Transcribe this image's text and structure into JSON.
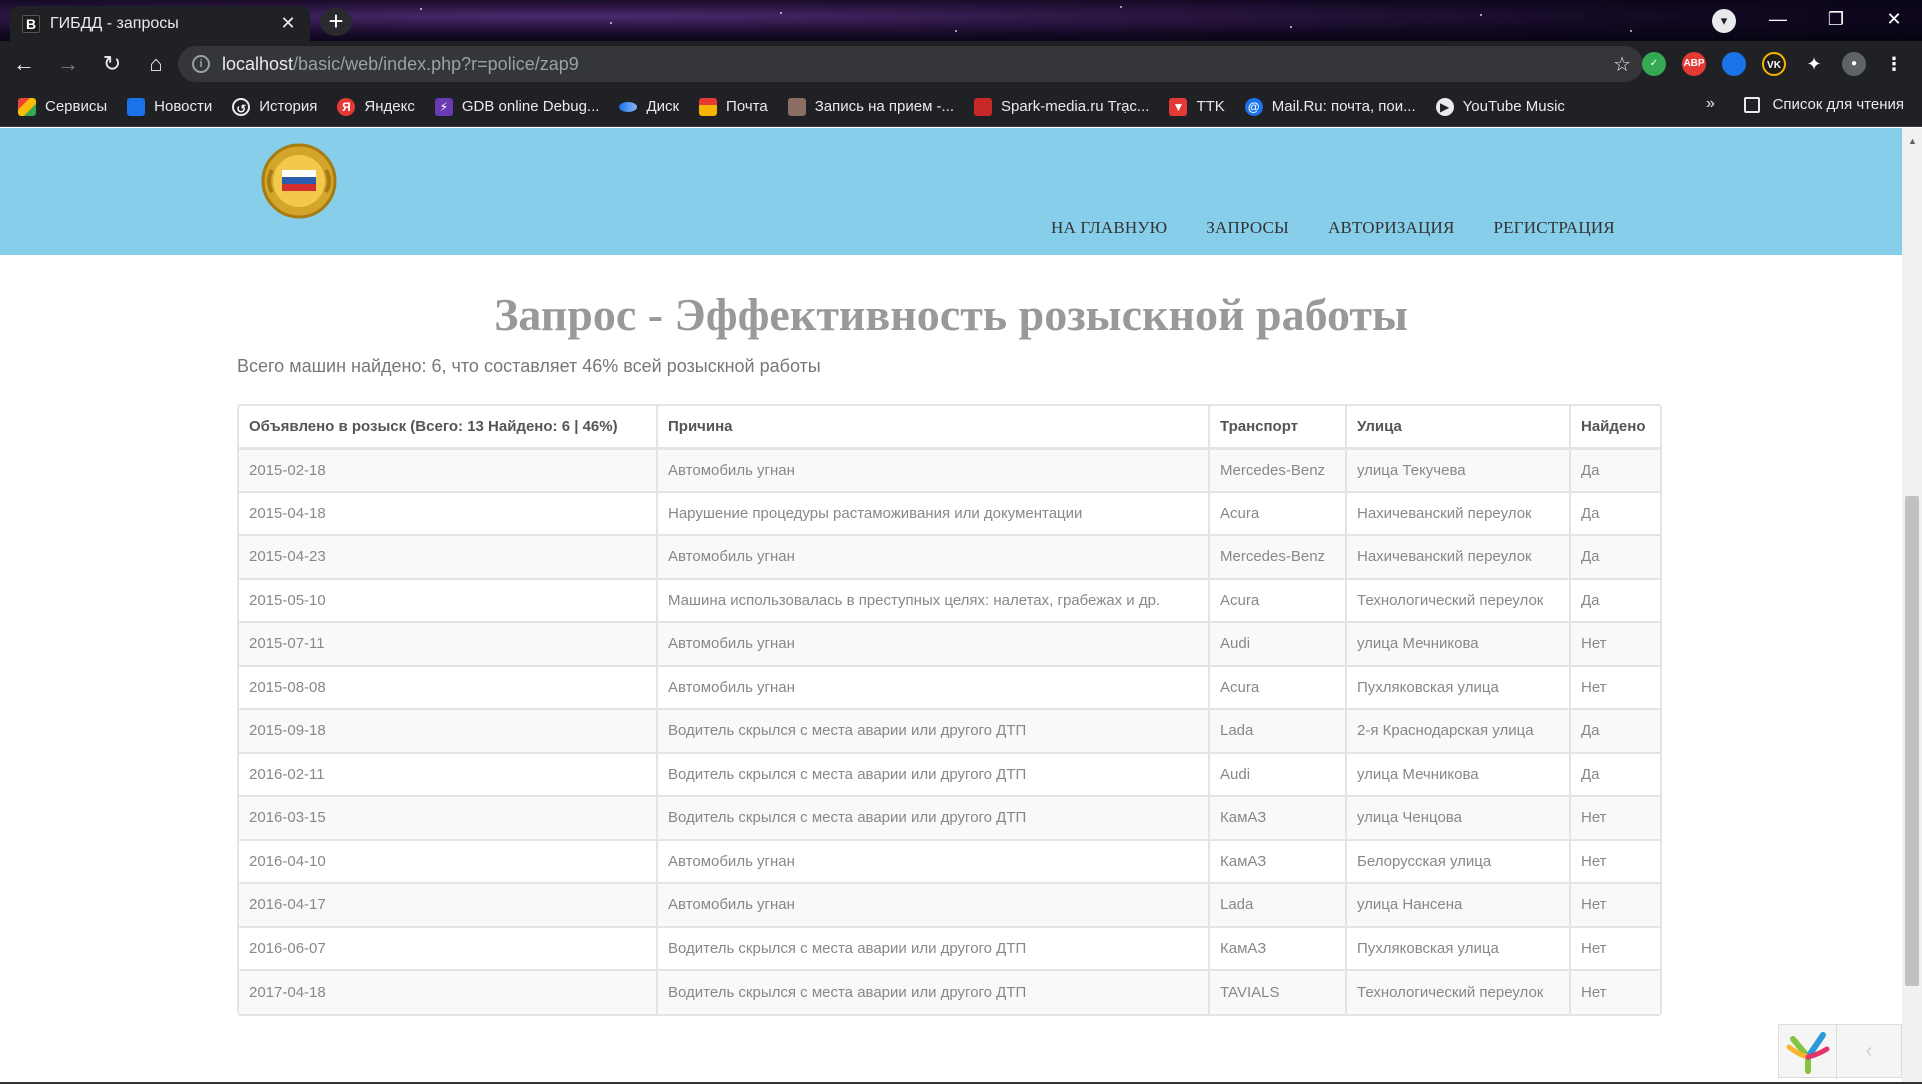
{
  "browser": {
    "tab_title": "ГИБДД - запросы",
    "tab_favicon": "В",
    "url_host": "localhost",
    "url_path": "/basic/web/index.php?r=police/zap9",
    "extensions": [
      {
        "name": "shield-extension-icon",
        "color": "#34a853",
        "label": ""
      },
      {
        "name": "adblock-extension-icon",
        "color": "#e53935",
        "label": "ABP"
      },
      {
        "name": "blue-extension-icon",
        "color": "#1a73e8",
        "label": ""
      },
      {
        "name": "vk-extension-icon",
        "color": "#1c1c1c",
        "label": "VK"
      }
    ]
  },
  "bookmarks": {
    "items": [
      {
        "label": "Сервисы",
        "icon": "apps-grid-icon",
        "color": "#ea4335"
      },
      {
        "label": "Новости",
        "icon": "news-icon",
        "color": "#1a73e8"
      },
      {
        "label": "История",
        "icon": "history-icon",
        "color": "#202124"
      },
      {
        "label": "Яндекс",
        "icon": "yandex-icon",
        "color": "#e53935"
      },
      {
        "label": "GDB online Debug...",
        "icon": "gdb-icon",
        "color": "#6a3ab2"
      },
      {
        "label": "Диск",
        "icon": "disk-icon",
        "color": "#1a73e8"
      },
      {
        "label": "Почта",
        "icon": "mail-icon",
        "color": "#f4b400"
      },
      {
        "label": "Запись на прием -...",
        "icon": "emblem-icon",
        "color": "#8d6e63"
      },
      {
        "label": "Spark-media.ru Trạc...",
        "icon": "spark-icon",
        "color": "#c62828"
      },
      {
        "label": "TTK",
        "icon": "ttk-icon",
        "color": "#e53935"
      },
      {
        "label": "Mail.Ru: почта, пои...",
        "icon": "mailru-icon",
        "color": "#1a73e8"
      },
      {
        "label": "YouTube Music",
        "icon": "youtube-music-icon",
        "color": "#e8eaed"
      }
    ],
    "more": "»",
    "reading_list": "Список для чтения"
  },
  "site": {
    "nav": [
      "НА ГЛАВНУЮ",
      "ЗАПРОСЫ",
      "АВТОРИЗАЦИЯ",
      "РЕГИСТРАЦИЯ"
    ],
    "header_color": "#87ceeb"
  },
  "main": {
    "title": "Запрос - Эффективность розыскной работы",
    "summary": "Всего машин найдено: 6, что составляет 46% всей розыскной работы",
    "table": {
      "headers": [
        "Объявлено в розыск (Всего: 13 Найдено: 6 | 46%)",
        "Причина",
        "Транспорт",
        "Улица",
        "Найдено"
      ],
      "rows": [
        [
          "2015-02-18",
          "Автомобиль угнан",
          "Mercedes-Benz",
          "улица Текучева",
          "Да"
        ],
        [
          "2015-04-18",
          "Нарушение процедуры растаможивания или документации",
          "Acura",
          "Нахичеванский переулок",
          "Да"
        ],
        [
          "2015-04-23",
          "Автомобиль угнан",
          "Mercedes-Benz",
          "Нахичеванский переулок",
          "Да"
        ],
        [
          "2015-05-10",
          "Машина использовалась в преступных целях: налетах, грабежах и др.",
          "Acura",
          "Технологический переулок",
          "Да"
        ],
        [
          "2015-07-11",
          "Автомобиль угнан",
          "Audi",
          "улица Мечникова",
          "Нет"
        ],
        [
          "2015-08-08",
          "Автомобиль угнан",
          "Acura",
          "Пухляковская улица",
          "Нет"
        ],
        [
          "2015-09-18",
          "Водитель скрылся с места аварии или другого ДТП",
          "Lada",
          "2-я Краснодарская улица",
          "Да"
        ],
        [
          "2016-02-11",
          "Водитель скрылся с места аварии или другого ДТП",
          "Audi",
          "улица Мечникова",
          "Да"
        ],
        [
          "2016-03-15",
          "Водитель скрылся с места аварии или другого ДТП",
          "КамАЗ",
          "улица Ченцова",
          "Нет"
        ],
        [
          "2016-04-10",
          "Автомобиль угнан",
          "КамАЗ",
          "Белорусская улица",
          "Нет"
        ],
        [
          "2016-04-17",
          "Автомобиль угнан",
          "Lada",
          "улица Нансена",
          "Нет"
        ],
        [
          "2016-06-07",
          "Водитель скрылся с места аварии или другого ДТП",
          "КамАЗ",
          "Пухляковская улица",
          "Нет"
        ],
        [
          "2017-04-18",
          "Водитель скрылся с места аварии или другого ДТП",
          "TAVIALS",
          "Технологический переулок",
          "Нет"
        ]
      ]
    }
  },
  "debug_toolbar": {
    "toggle": "‹"
  }
}
